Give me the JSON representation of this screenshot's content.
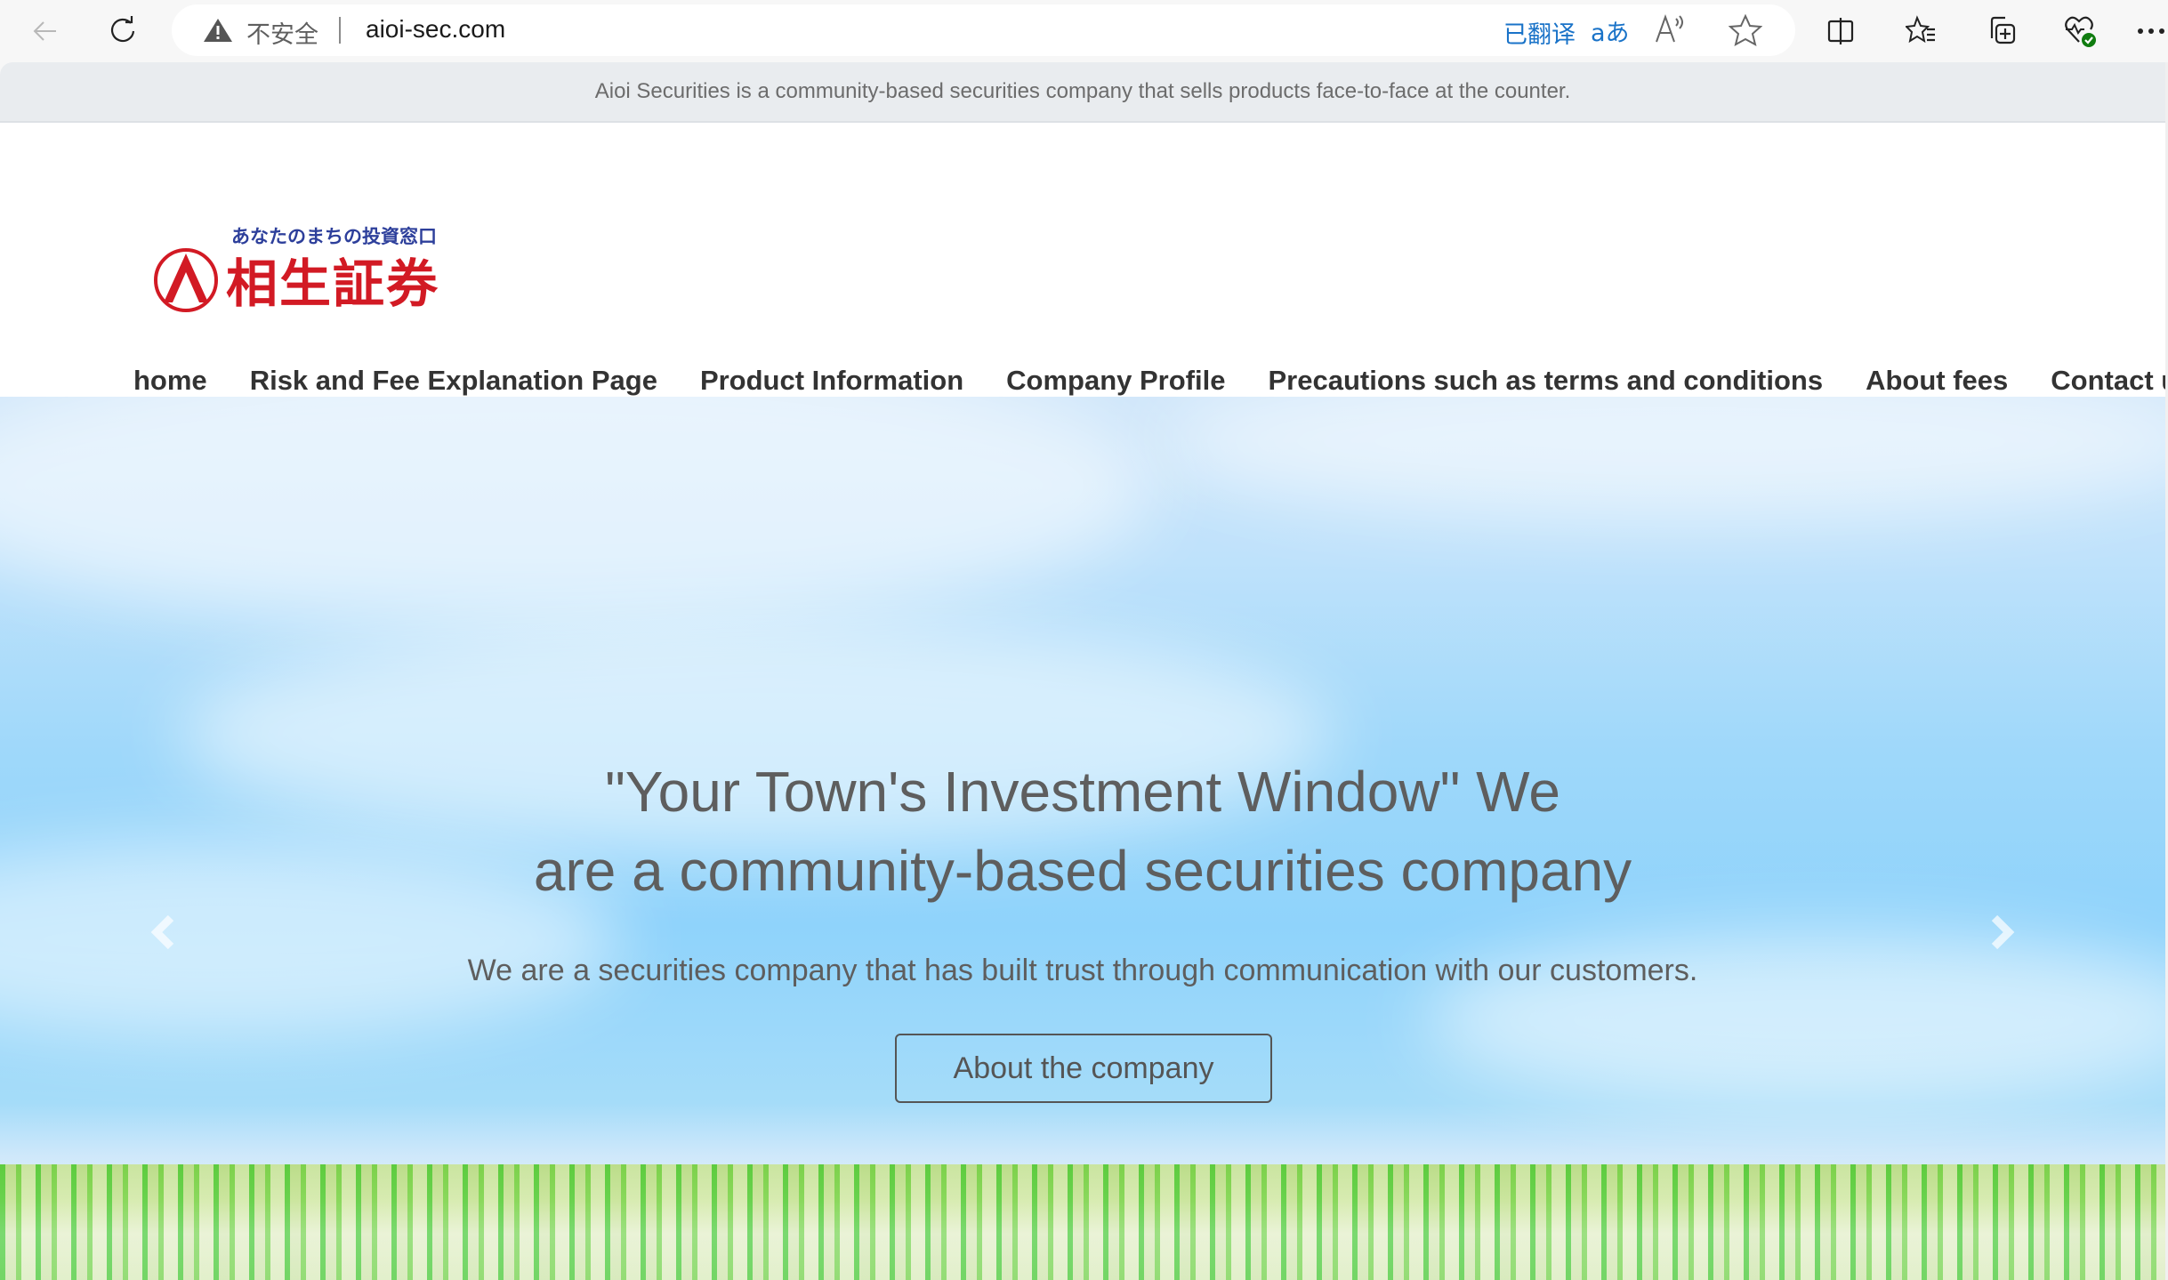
{
  "browser": {
    "security_label": "不安全",
    "url": "aioi-sec.com",
    "translated_label": "已翻译",
    "translate_icon_text": "aあ",
    "icons": [
      "back-arrow-icon",
      "refresh-icon",
      "warning-icon",
      "read-aloud-icon",
      "favorite-star-icon",
      "split-screen-icon",
      "favorites-list-icon",
      "collections-icon",
      "browser-essentials-icon",
      "more-menu-icon"
    ]
  },
  "info_strip": {
    "text": "Aioi Securities is a community-based securities company that sells products face-to-face at the counter."
  },
  "logo": {
    "tagline": "あなたのまちの投資窓口",
    "name": "相生証券",
    "brand_color": "#d21a24",
    "tagline_color": "#2d3f9b"
  },
  "nav": {
    "active_color": "#8f1010",
    "items": [
      {
        "label": "home",
        "active": true
      },
      {
        "label": "Risk and Fee Explanation Page",
        "active": false
      },
      {
        "label": "Product Information",
        "active": false
      },
      {
        "label": "Company Profile",
        "active": false
      },
      {
        "label": "Precautions such as terms and conditions",
        "active": false
      },
      {
        "label": "About fees",
        "active": false
      },
      {
        "label": "Contact us",
        "active": false
      }
    ]
  },
  "hero": {
    "title_line1": "\"Your Town's Investment Window\" We",
    "title_line2": "are a community-based securities company",
    "subtitle": "We are a securities company that has built trust through communication with our customers.",
    "button_label": "About the company",
    "prev_icon": "chevron-left-icon",
    "next_icon": "chevron-right-icon"
  }
}
